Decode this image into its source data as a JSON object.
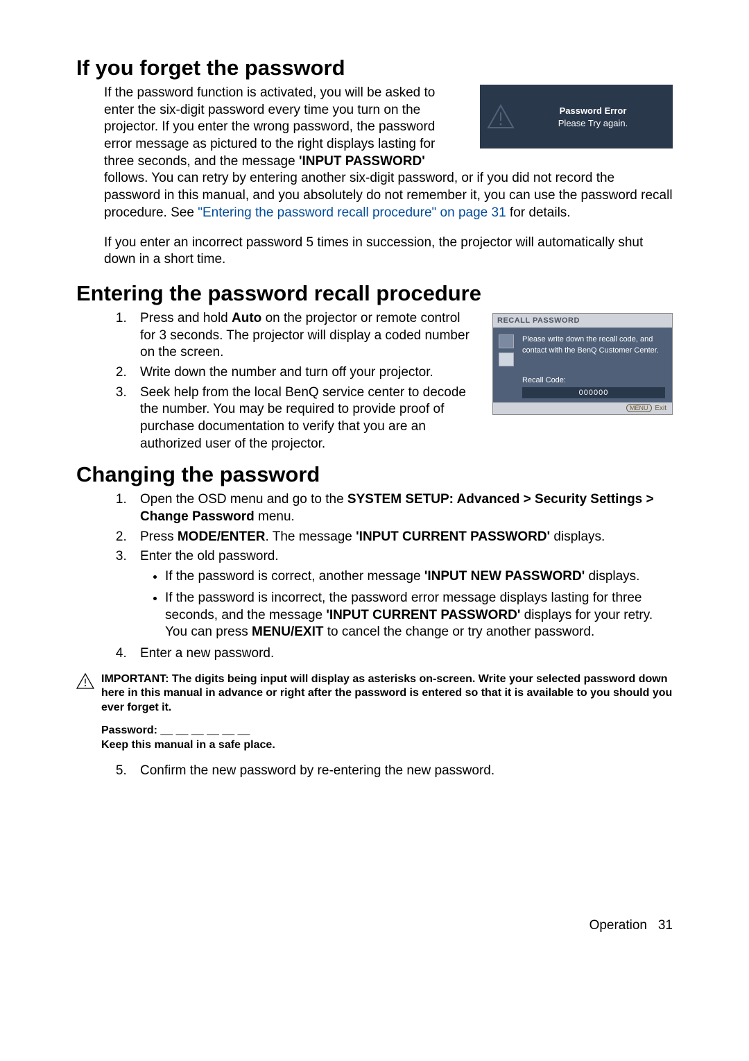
{
  "section1": {
    "heading": "If you forget the password",
    "p1_pre": "If the password function is activated, you will be asked to enter the six-digit password every time you turn on the projector. If you enter the wrong password, the password error message as pictured to the right displays lasting for three seconds, and the message ",
    "p1_bold": "'INPUT PASSWORD'",
    "p1_mid": " follows. You can retry by entering another six-digit password, or if you did not record the password in this manual, and you absolutely do not remember it, you can use the password recall procedure. See ",
    "p1_link": "\"Entering the password recall procedure\" on page 31",
    "p1_post": " for details.",
    "p2": "If you enter an incorrect password 5 times in succession, the projector will automatically shut down in a short time."
  },
  "error_box": {
    "title": "Password Error",
    "msg": "Please Try again."
  },
  "section2": {
    "heading": "Entering the password recall procedure",
    "li1_pre": "Press and hold ",
    "li1_bold": "Auto",
    "li1_post": " on the projector or remote control for 3 seconds. The projector will display a coded number on the screen.",
    "li2": "Write down the number and turn off your projector.",
    "li3": "Seek help from the local BenQ service center to decode the number. You may be required to provide proof of purchase documentation to verify that you are an authorized user of the projector."
  },
  "recall_box": {
    "header": "RECALL PASSWORD",
    "msg": "Please write down the recall code, and contact with the BenQ Customer Center.",
    "code_label": "Recall Code:",
    "code_value": "000000",
    "footer_btn": "MENU",
    "footer_exit": "Exit"
  },
  "section3": {
    "heading": "Changing the password",
    "li1_pre": "Open the OSD menu and go to the ",
    "li1_bold": "SYSTEM SETUP: Advanced > Security Settings > Change Password",
    "li1_post": " menu.",
    "li2_pre": "Press ",
    "li2_b1": "MODE/ENTER",
    "li2_mid": ". The message ",
    "li2_b2": "'INPUT CURRENT PASSWORD'",
    "li2_post": " displays.",
    "li3": "Enter the old password.",
    "li3_b1_pre": "If the password is correct, another message ",
    "li3_b1_bold": "'INPUT NEW PASSWORD'",
    "li3_b1_post": " displays.",
    "li3_b2_pre": "If the password is incorrect, the password error message displays lasting for three seconds, and the message ",
    "li3_b2_bold1": "'INPUT CURRENT PASSWORD'",
    "li3_b2_mid": " displays for your retry. You can press ",
    "li3_b2_bold2": "MENU/EXIT",
    "li3_b2_post": " to cancel the change or try another password.",
    "li4": "Enter a new password.",
    "warn": "IMPORTANT: The digits being input will display as asterisks on-screen. Write your selected password down here in this manual in advance or right after the password is entered so that it is available to you should you ever forget it.",
    "pw_line": "Password: __ __ __ __ __ __",
    "keep": "Keep this manual in a safe place.",
    "li5": "Confirm the new password by re-entering the new password."
  },
  "footer": {
    "label": "Operation",
    "page": "31"
  }
}
